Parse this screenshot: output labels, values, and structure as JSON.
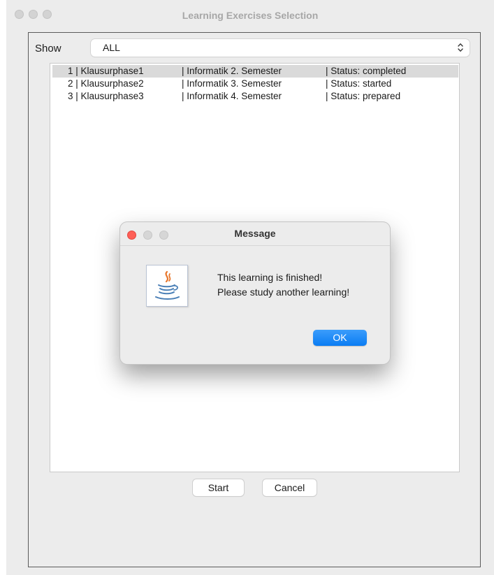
{
  "window": {
    "title": "Learning Exercises Selection"
  },
  "filter": {
    "label": "Show",
    "selected": "ALL"
  },
  "list": {
    "items": [
      {
        "id": "1 | Klausurphase1",
        "course": "| Informatik 2. Semester",
        "status": "| Status: completed",
        "selected": true
      },
      {
        "id": "2 | Klausurphase2",
        "course": "| Informatik 3. Semester",
        "status": "| Status: started",
        "selected": false
      },
      {
        "id": "3 | Klausurphase3",
        "course": "| Informatik 4. Semester",
        "status": "| Status: prepared",
        "selected": false
      }
    ]
  },
  "buttons": {
    "start": "Start",
    "cancel": "Cancel"
  },
  "dialog": {
    "title": "Message",
    "line1": "This learning is finished!",
    "line2": "Please study another learning!",
    "ok": "OK",
    "icon": "java-icon"
  },
  "colors": {
    "accent": "#0a7cf3",
    "close_red": "#fe5f57",
    "selection": "#dadada"
  }
}
